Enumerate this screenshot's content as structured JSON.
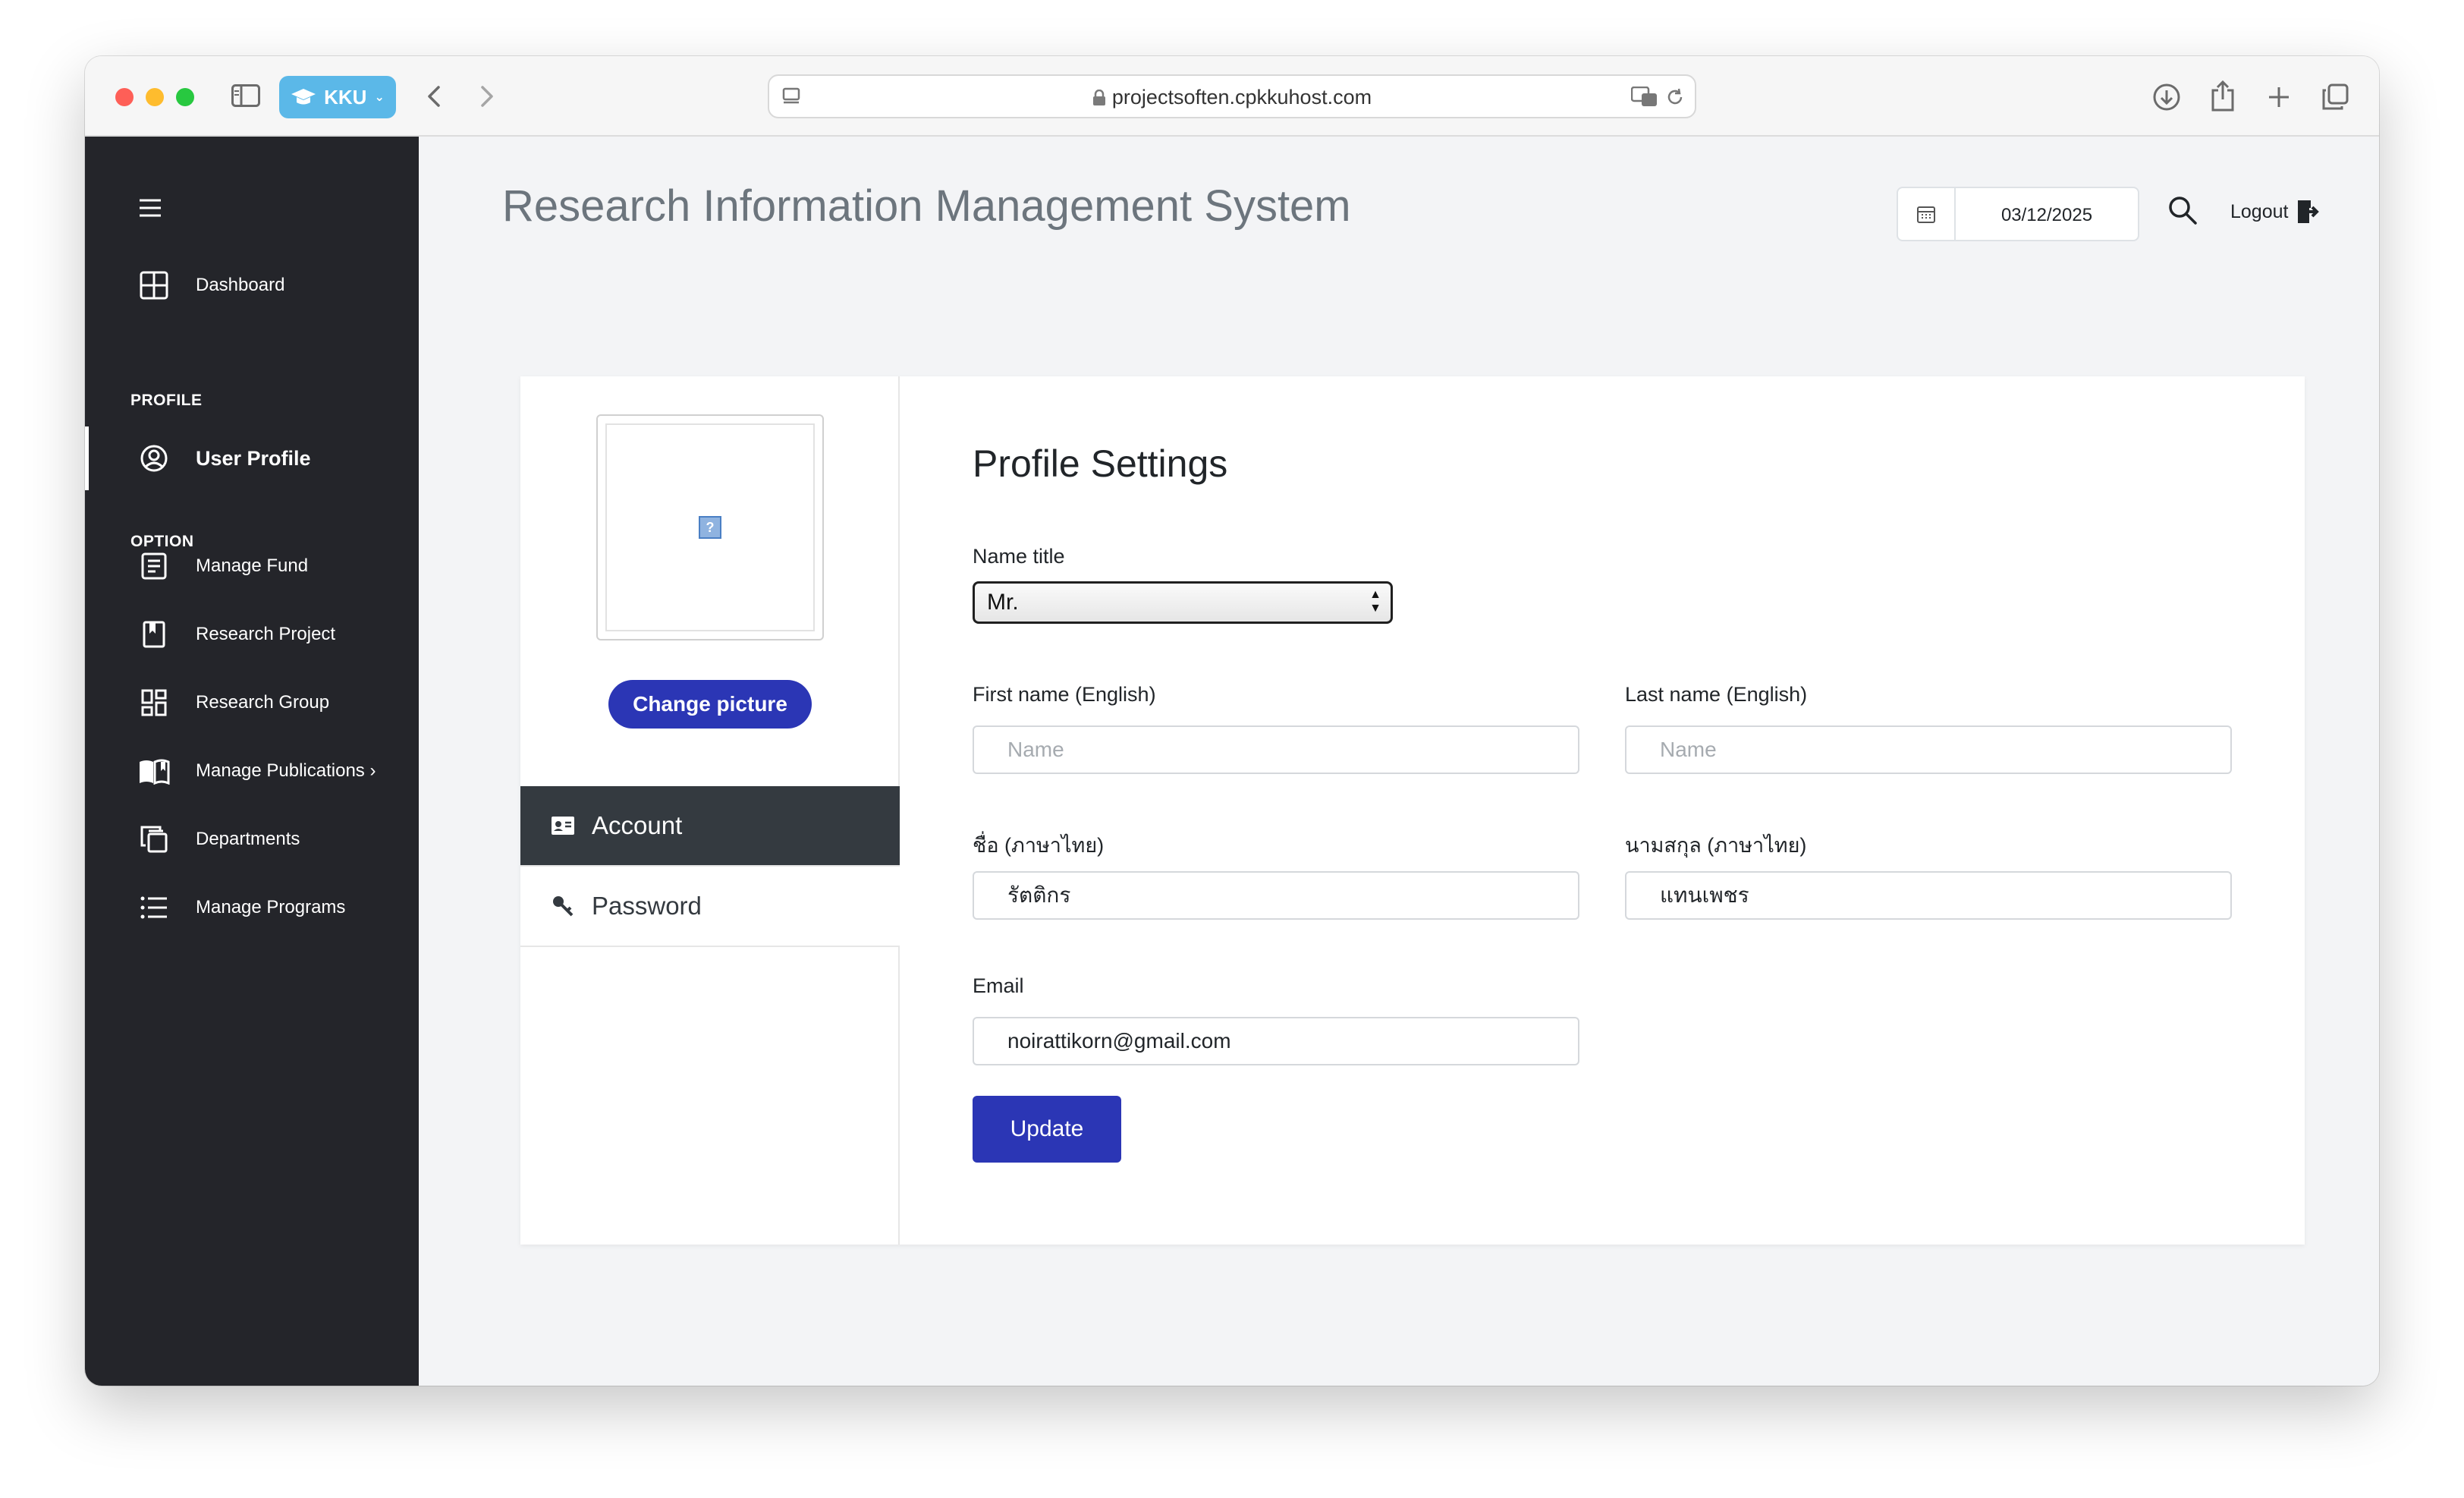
{
  "browser": {
    "profile_button": "KKU",
    "url": "projectsoften.cpkkuhost.com"
  },
  "sidebar": {
    "items_top": [
      {
        "label": "Dashboard",
        "icon": "dashboard-grid-icon"
      }
    ],
    "section_profile": "PROFILE",
    "profile_item": {
      "label": "User Profile",
      "icon": "user-circle-icon"
    },
    "section_option": "OPTION",
    "option_items": [
      {
        "label": "Manage Fund",
        "icon": "document-list-icon"
      },
      {
        "label": "Research Project",
        "icon": "bookmark-icon"
      },
      {
        "label": "Research Group",
        "icon": "group-grid-icon"
      },
      {
        "label": "Manage Publications ›",
        "icon": "book-open-icon"
      },
      {
        "label": "Departments",
        "icon": "copy-stack-icon"
      },
      {
        "label": "Manage Programs",
        "icon": "list-icon"
      }
    ]
  },
  "header": {
    "title": "Research Information Management System",
    "date": "03/12/2025",
    "logout_label": "Logout"
  },
  "profile_card": {
    "change_picture_label": "Change picture",
    "tabs": [
      {
        "label": "Account",
        "icon": "id-card-icon"
      },
      {
        "label": "Password",
        "icon": "key-icon"
      }
    ]
  },
  "form": {
    "title": "Profile Settings",
    "name_title_label": "Name title",
    "name_title_value": "Mr.",
    "first_name_en_label": "First name (English)",
    "first_name_en_placeholder": "Name",
    "last_name_en_label": "Last name (English)",
    "last_name_en_placeholder": "Name",
    "first_name_th_label": "ชื่อ (ภาษาไทย)",
    "first_name_th_value": "รัตติกร",
    "last_name_th_label": "นามสกุล (ภาษาไทย)",
    "last_name_th_value": "แทนเพชร",
    "email_label": "Email",
    "email_value": "noirattikorn@gmail.com",
    "update_label": "Update"
  },
  "colors": {
    "sidebar_bg": "#24252a",
    "primary_button": "#2b36b5",
    "active_tab": "#343a40",
    "page_bg": "#f3f4f6"
  }
}
